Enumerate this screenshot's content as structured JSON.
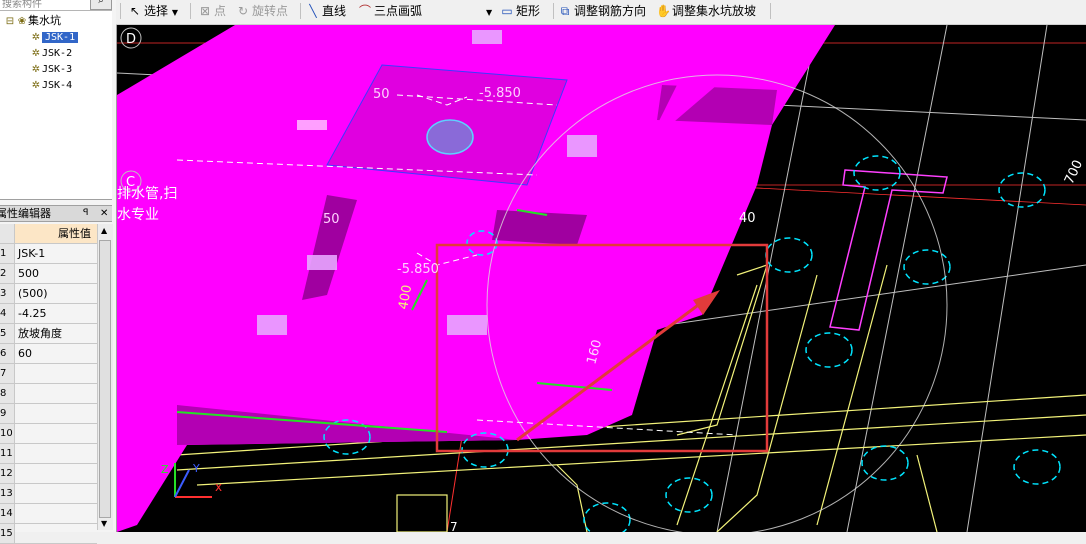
{
  "left_panel": {
    "search": {
      "placeholder": "搜索构件",
      "button_icon": "search-icon"
    },
    "tree": {
      "root": "集水坑",
      "items": [
        "JSK-1",
        "JSK-2",
        "JSK-3",
        "JSK-4"
      ],
      "selected": "JSK-1"
    },
    "properties": {
      "title": "属性编辑器",
      "value_header": "属性值",
      "rows": [
        {
          "num": "1",
          "value": "JSK-1"
        },
        {
          "num": "2",
          "value": "500"
        },
        {
          "num": "3",
          "value": "(500)"
        },
        {
          "num": "4",
          "value": "-4.25"
        },
        {
          "num": "5",
          "value": "放坡角度"
        },
        {
          "num": "6",
          "value": "60"
        },
        {
          "num": "7",
          "value": ""
        },
        {
          "num": "8",
          "value": ""
        },
        {
          "num": "9",
          "value": ""
        },
        {
          "num": "10",
          "value": ""
        },
        {
          "num": "11",
          "value": ""
        },
        {
          "num": "12",
          "value": ""
        },
        {
          "num": "13",
          "value": ""
        },
        {
          "num": "14",
          "value": ""
        },
        {
          "num": "15",
          "value": ""
        }
      ]
    }
  },
  "toolbar": {
    "select": "选择",
    "point": "点",
    "rotate_point": "旋转点",
    "line": "直线",
    "three_point_arc": "三点画弧",
    "rectangle": "矩形",
    "adjust_rebar_direction": "调整钢筋方向",
    "adjust_pit_slope": "调整集水坑放坡"
  },
  "canvas": {
    "axis_labels": [
      "D",
      "C",
      "7"
    ],
    "dim_texts": [
      "-5.850",
      "-5.850",
      "700",
      "400",
      "160",
      "50",
      "50",
      "40"
    ],
    "background_text": [
      "排水管,扫",
      "水专业"
    ],
    "colors": {
      "background": "#000000",
      "slab": "#ff00ff",
      "highlight": "#e23b3b",
      "grid": "#ffffff",
      "rebar": "#ffff66",
      "pit": "#00e5ff"
    }
  }
}
